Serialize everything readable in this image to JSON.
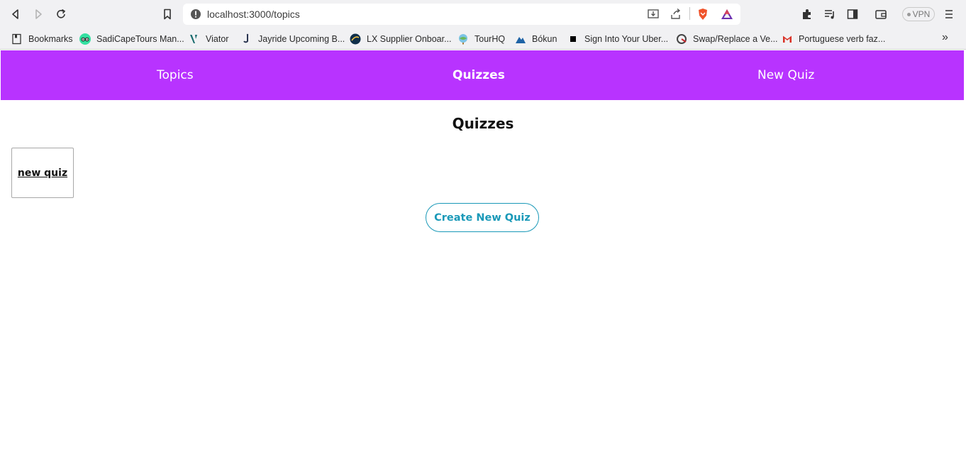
{
  "browser": {
    "url": "localhost:3000/topics",
    "vpn_label": "VPN",
    "bookmarks": [
      {
        "label": "Bookmarks",
        "icon": "bookmarks-manager-icon"
      },
      {
        "label": "SadiCapeTours Man...",
        "icon": "tripadvisor-icon"
      },
      {
        "label": "Viator",
        "icon": "viator-icon"
      },
      {
        "label": "Jayride Upcoming B...",
        "icon": "jayride-icon"
      },
      {
        "label": "LX Supplier Onboar...",
        "icon": "lx-icon"
      },
      {
        "label": "TourHQ",
        "icon": "tourhq-icon"
      },
      {
        "label": "Bókun",
        "icon": "bokun-icon"
      },
      {
        "label": "Sign Into Your Uber...",
        "icon": "uber-icon"
      },
      {
        "label": "Swap/Replace a Ve...",
        "icon": "swap-icon"
      },
      {
        "label": "Portuguese verb faz...",
        "icon": "gmail-icon"
      }
    ],
    "more_label": "»"
  },
  "nav": {
    "topics": "Topics",
    "quizzes": "Quizzes",
    "new_quiz": "New Quiz"
  },
  "page": {
    "title": "Quizzes",
    "quizzes": [
      {
        "name": "new quiz"
      }
    ],
    "create_button": "Create New Quiz"
  },
  "colors": {
    "nav_bg": "#b833ff",
    "button_accent": "#1a99b8"
  }
}
